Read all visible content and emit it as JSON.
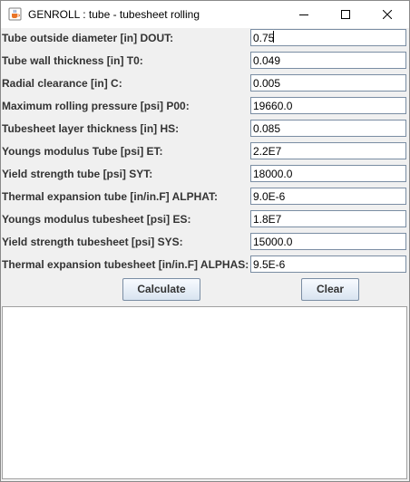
{
  "window": {
    "title": "GENROLL : tube - tubesheet rolling"
  },
  "fields": [
    {
      "label": "Tube outside diameter [in] DOUT:",
      "value": "0.75"
    },
    {
      "label": "Tube wall thickness [in] T0:",
      "value": "0.049"
    },
    {
      "label": "Radial clearance [in] C:",
      "value": "0.005"
    },
    {
      "label": "Maximum rolling pressure [psi] P00:",
      "value": "19660.0"
    },
    {
      "label": "Tubesheet layer thickness [in] HS:",
      "value": "0.085"
    },
    {
      "label": "Youngs modulus Tube [psi] ET:",
      "value": "2.2E7"
    },
    {
      "label": "Yield strength tube [psi] SYT:",
      "value": "18000.0"
    },
    {
      "label": "Thermal expansion tube [in/in.F] ALPHAT:",
      "value": "9.0E-6"
    },
    {
      "label": "Youngs modulus tubesheet [psi] ES:",
      "value": "1.8E7"
    },
    {
      "label": "Yield strength tubesheet [psi] SYS:",
      "value": "15000.0"
    },
    {
      "label": "Thermal expansion tubesheet [in/in.F] ALPHAS:",
      "value": "9.5E-6"
    }
  ],
  "buttons": {
    "calculate_label": "Calculate",
    "clear_label": "Clear"
  },
  "output": {
    "text": ""
  },
  "colors": {
    "window_bg": "#f0f0f0",
    "field_border": "#7a8da3",
    "label_text": "#333333"
  },
  "icons": {
    "app": "java-coffee-cup-icon",
    "minimize": "minimize-icon",
    "maximize": "maximize-icon",
    "close": "close-icon"
  }
}
